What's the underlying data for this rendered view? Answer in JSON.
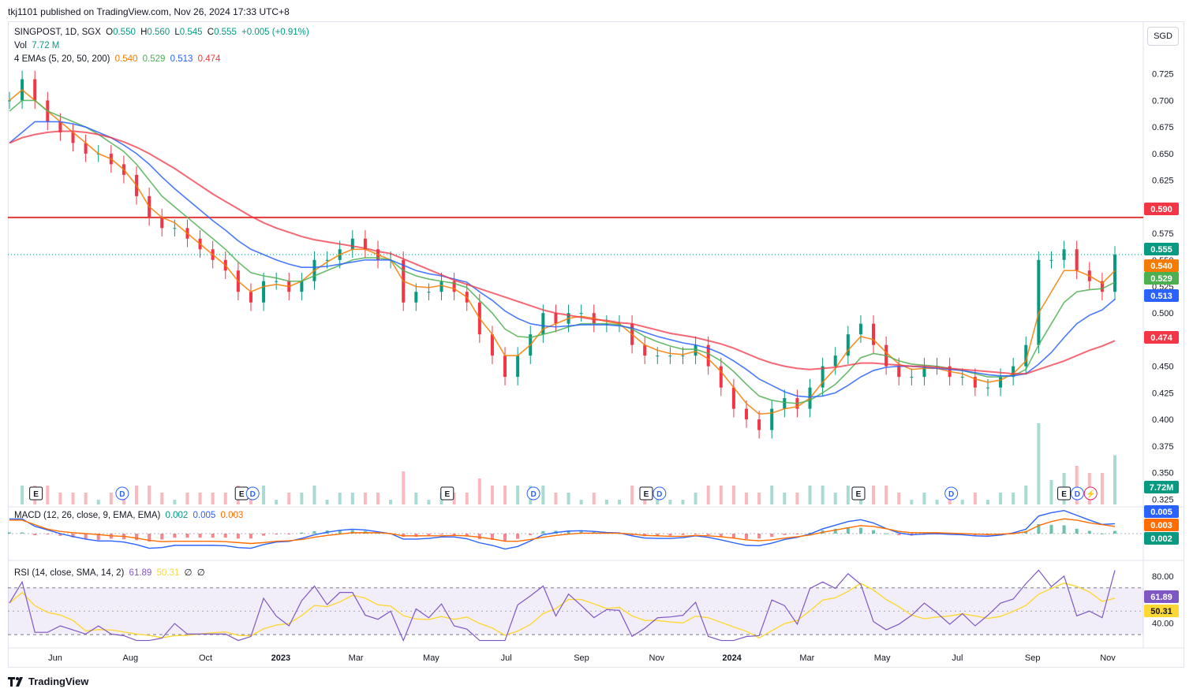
{
  "publisher_line": "tkj1101 published on TradingView.com, Nov 26, 2024 17:33 UTC+8",
  "currency_button": "SGD",
  "footer_brand": "TradingView",
  "colors": {
    "up": "#089981",
    "down": "#f23645",
    "ema5": "#f57c00",
    "ema20": "#4caf50",
    "ema50": "#2962ff",
    "ema200": "#f23645",
    "hline": "#e53935",
    "macd": "#2962ff",
    "signal": "#ff6d00",
    "rsi": "#7e57c2",
    "rsi_ma": "#fdd835"
  },
  "legend": {
    "symbol": "SINGPOST, 1D, SGX",
    "o_label": "O",
    "o": "0.550",
    "h_label": "H",
    "h": "0.560",
    "l_label": "L",
    "l": "0.545",
    "c_label": "C",
    "c": "0.555",
    "change": "+0.005 (+0.91%)",
    "vol_label": "Vol",
    "vol": "7.72 M",
    "ema_label": "4 EMAs (5, 20, 50, 200)",
    "ema5": "0.540",
    "ema20": "0.529",
    "ema50": "0.513",
    "ema200": "0.474",
    "macd_label": "MACD (12, 26, close, 9, EMA, EMA)",
    "macd_hist": "0.002",
    "macd_line": "0.005",
    "macd_signal": "0.003",
    "rsi_label": "RSI (14, close, SMA, 14, 2)",
    "rsi": "61.89",
    "rsi_ma": "50.31",
    "rsi_extra1": "∅",
    "rsi_extra2": "∅"
  },
  "chart_data": {
    "type": "line",
    "symbol": "SINGPOST",
    "interval": "1D",
    "x_ticks": [
      "Jun",
      "Aug",
      "Oct",
      "2023",
      "Mar",
      "May",
      "Jul",
      "Sep",
      "Nov",
      "2024",
      "Mar",
      "May",
      "Jul",
      "Sep",
      "Nov"
    ],
    "price_ticks": [
      0.725,
      0.7,
      0.675,
      0.65,
      0.625,
      0.6,
      0.575,
      0.55,
      0.525,
      0.5,
      0.475,
      0.45,
      0.425,
      0.4,
      0.375,
      0.35,
      0.325
    ],
    "price_tick_labels": [
      "0.725",
      "0.700",
      "0.675",
      "0.650",
      "0.625",
      "0.600",
      "0.575",
      "0.550",
      "0.525",
      "0.500",
      "0.475",
      "0.450",
      "0.425",
      "0.400",
      "0.375",
      "0.350",
      "0.325"
    ],
    "price_range": [
      0.32,
      0.75
    ],
    "horizontal_line": 0.59,
    "series": [
      {
        "name": "Close",
        "values": [
          0.7,
          0.72,
          0.7,
          0.68,
          0.67,
          0.66,
          0.65,
          0.65,
          0.64,
          0.63,
          0.61,
          0.59,
          0.58,
          0.58,
          0.57,
          0.56,
          0.55,
          0.54,
          0.52,
          0.51,
          0.53,
          0.53,
          0.52,
          0.53,
          0.55,
          0.55,
          0.56,
          0.57,
          0.56,
          0.55,
          0.55,
          0.51,
          0.52,
          0.52,
          0.53,
          0.52,
          0.51,
          0.48,
          0.46,
          0.44,
          0.46,
          0.48,
          0.5,
          0.49,
          0.5,
          0.5,
          0.49,
          0.49,
          0.49,
          0.47,
          0.46,
          0.46,
          0.46,
          0.46,
          0.47,
          0.45,
          0.43,
          0.41,
          0.4,
          0.39,
          0.41,
          0.42,
          0.41,
          0.43,
          0.45,
          0.46,
          0.48,
          0.49,
          0.47,
          0.45,
          0.44,
          0.44,
          0.45,
          0.45,
          0.44,
          0.44,
          0.43,
          0.43,
          0.44,
          0.45,
          0.47,
          0.55,
          0.55,
          0.56,
          0.54,
          0.53,
          0.52,
          0.555
        ]
      },
      {
        "name": "EMA 5",
        "values": [
          0.7,
          0.71,
          0.7,
          0.69,
          0.68,
          0.67,
          0.66,
          0.65,
          0.645,
          0.635,
          0.62,
          0.6,
          0.59,
          0.585,
          0.575,
          0.565,
          0.555,
          0.545,
          0.53,
          0.52,
          0.525,
          0.527,
          0.525,
          0.53,
          0.54,
          0.548,
          0.555,
          0.56,
          0.56,
          0.555,
          0.55,
          0.53,
          0.525,
          0.524,
          0.526,
          0.523,
          0.515,
          0.495,
          0.48,
          0.46,
          0.46,
          0.47,
          0.485,
          0.49,
          0.495,
          0.497,
          0.495,
          0.492,
          0.49,
          0.48,
          0.47,
          0.465,
          0.462,
          0.461,
          0.464,
          0.457,
          0.445,
          0.43,
          0.415,
          0.405,
          0.406,
          0.41,
          0.412,
          0.42,
          0.435,
          0.448,
          0.465,
          0.478,
          0.475,
          0.463,
          0.452,
          0.447,
          0.448,
          0.448,
          0.445,
          0.443,
          0.438,
          0.435,
          0.437,
          0.443,
          0.455,
          0.5,
          0.52,
          0.54,
          0.54,
          0.535,
          0.528,
          0.54
        ]
      },
      {
        "name": "EMA 20",
        "values": [
          0.69,
          0.7,
          0.7,
          0.69,
          0.685,
          0.68,
          0.675,
          0.668,
          0.66,
          0.652,
          0.64,
          0.625,
          0.61,
          0.6,
          0.59,
          0.58,
          0.57,
          0.56,
          0.548,
          0.538,
          0.535,
          0.533,
          0.53,
          0.53,
          0.535,
          0.54,
          0.545,
          0.55,
          0.552,
          0.552,
          0.55,
          0.54,
          0.535,
          0.532,
          0.53,
          0.528,
          0.524,
          0.512,
          0.5,
          0.485,
          0.478,
          0.477,
          0.48,
          0.483,
          0.487,
          0.49,
          0.49,
          0.49,
          0.489,
          0.485,
          0.478,
          0.473,
          0.469,
          0.466,
          0.466,
          0.462,
          0.455,
          0.445,
          0.433,
          0.422,
          0.418,
          0.416,
          0.415,
          0.418,
          0.425,
          0.433,
          0.445,
          0.458,
          0.462,
          0.46,
          0.455,
          0.452,
          0.451,
          0.45,
          0.448,
          0.446,
          0.443,
          0.44,
          0.44,
          0.441,
          0.447,
          0.47,
          0.49,
          0.51,
          0.52,
          0.522,
          0.523,
          0.529
        ]
      },
      {
        "name": "EMA 50",
        "values": [
          0.66,
          0.67,
          0.68,
          0.68,
          0.68,
          0.678,
          0.675,
          0.67,
          0.665,
          0.658,
          0.65,
          0.64,
          0.628,
          0.617,
          0.607,
          0.597,
          0.587,
          0.578,
          0.568,
          0.56,
          0.555,
          0.55,
          0.546,
          0.543,
          0.543,
          0.544,
          0.546,
          0.548,
          0.55,
          0.55,
          0.55,
          0.545,
          0.54,
          0.537,
          0.535,
          0.532,
          0.529,
          0.52,
          0.512,
          0.502,
          0.495,
          0.49,
          0.488,
          0.487,
          0.488,
          0.489,
          0.489,
          0.489,
          0.488,
          0.486,
          0.482,
          0.478,
          0.475,
          0.472,
          0.47,
          0.467,
          0.462,
          0.455,
          0.447,
          0.438,
          0.432,
          0.426,
          0.422,
          0.421,
          0.422,
          0.425,
          0.432,
          0.44,
          0.446,
          0.449,
          0.45,
          0.45,
          0.449,
          0.448,
          0.447,
          0.446,
          0.444,
          0.442,
          0.441,
          0.441,
          0.443,
          0.452,
          0.463,
          0.477,
          0.49,
          0.498,
          0.503,
          0.513
        ]
      },
      {
        "name": "EMA 200",
        "values": [
          0.66,
          0.665,
          0.668,
          0.67,
          0.671,
          0.671,
          0.67,
          0.668,
          0.665,
          0.661,
          0.656,
          0.65,
          0.643,
          0.636,
          0.628,
          0.62,
          0.612,
          0.605,
          0.598,
          0.591,
          0.585,
          0.58,
          0.576,
          0.572,
          0.569,
          0.567,
          0.565,
          0.563,
          0.561,
          0.558,
          0.556,
          0.551,
          0.546,
          0.541,
          0.536,
          0.531,
          0.527,
          0.523,
          0.519,
          0.515,
          0.511,
          0.507,
          0.503,
          0.5,
          0.498,
          0.496,
          0.494,
          0.493,
          0.491,
          0.49,
          0.487,
          0.484,
          0.481,
          0.479,
          0.477,
          0.474,
          0.471,
          0.467,
          0.462,
          0.457,
          0.453,
          0.45,
          0.448,
          0.447,
          0.448,
          0.449,
          0.451,
          0.453,
          0.453,
          0.452,
          0.451,
          0.45,
          0.45,
          0.449,
          0.448,
          0.447,
          0.446,
          0.445,
          0.444,
          0.443,
          0.443,
          0.447,
          0.451,
          0.455,
          0.46,
          0.465,
          0.469,
          0.474
        ]
      }
    ],
    "volume_last": "7.72M",
    "macd_range": [
      -0.03,
      0.03
    ],
    "rsi_ticks": [
      80,
      40
    ],
    "rsi_tick_labels": [
      "80.00",
      "40.00"
    ],
    "rsi_range": [
      20,
      90
    ],
    "rsi_band": [
      30,
      70
    ],
    "price_tags": [
      {
        "value": 0.59,
        "label": "0.590",
        "color": "#f23645"
      },
      {
        "value": 0.555,
        "label": "0.555",
        "color": "#089981"
      },
      {
        "value": 0.54,
        "label": "0.540",
        "color": "#f57c00"
      },
      {
        "value": 0.529,
        "label": "0.529",
        "color": "#4caf50"
      },
      {
        "value": 0.513,
        "label": "0.513",
        "color": "#2962ff"
      },
      {
        "value": 0.474,
        "label": "0.474",
        "color": "#f23645"
      }
    ],
    "volume_tag": {
      "label": "7.72M",
      "color": "#089981"
    },
    "macd_tags": [
      {
        "label": "0.005",
        "color": "#2962ff"
      },
      {
        "label": "0.003",
        "color": "#ff6d00"
      },
      {
        "label": "0.002",
        "color": "#089981"
      }
    ],
    "rsi_tags": [
      {
        "label": "61.89",
        "color": "#7e57c2",
        "text": "#ffffff"
      },
      {
        "label": "50.31",
        "color": "#fdd835",
        "text": "#131722"
      }
    ],
    "event_markers": [
      {
        "kind": "E",
        "x_frac": 0.024
      },
      {
        "kind": "D",
        "x_frac": 0.102
      },
      {
        "kind": "E",
        "x_frac": 0.21
      },
      {
        "kind": "D",
        "x_frac": 0.22
      },
      {
        "kind": "E",
        "x_frac": 0.396
      },
      {
        "kind": "D",
        "x_frac": 0.474
      },
      {
        "kind": "E",
        "x_frac": 0.576
      },
      {
        "kind": "D",
        "x_frac": 0.588
      },
      {
        "kind": "E",
        "x_frac": 0.768
      },
      {
        "kind": "D",
        "x_frac": 0.852
      },
      {
        "kind": "E",
        "x_frac": 0.954
      },
      {
        "kind": "D",
        "x_frac": 0.966
      },
      {
        "kind": "S",
        "x_frac": 0.978
      }
    ]
  }
}
